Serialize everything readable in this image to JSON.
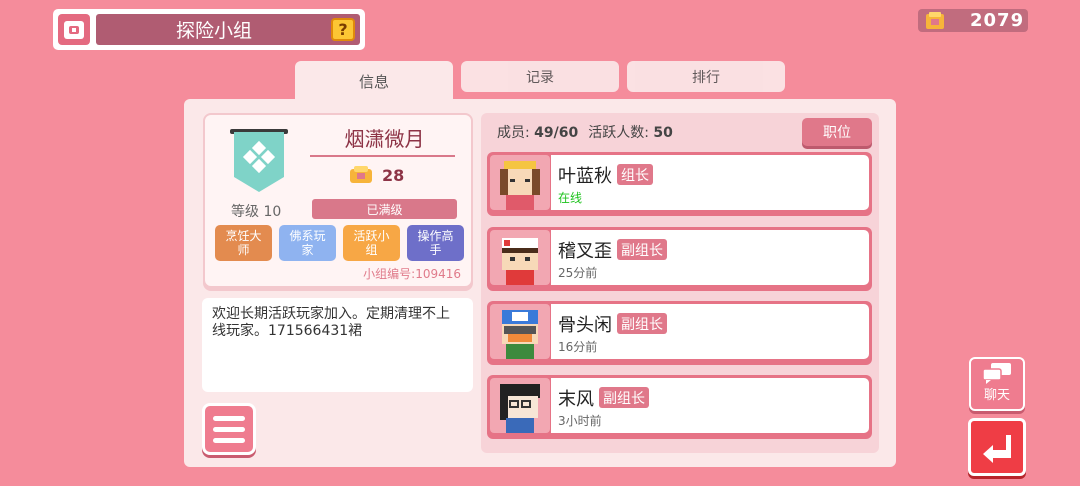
{
  "header": {
    "title": "探险小组",
    "help_label": "?",
    "coins": "2079"
  },
  "tabs": [
    {
      "label": "信息",
      "active": true
    },
    {
      "label": "记录",
      "active": false
    },
    {
      "label": "排行",
      "active": false
    }
  ],
  "group": {
    "name": "烟潇微月",
    "points": "28",
    "level": "等级 10",
    "level_status": "已满级",
    "tags": [
      {
        "label": "烹饪大师",
        "color": "#e38b4f"
      },
      {
        "label": "佛系玩家",
        "color": "#8fb3f0"
      },
      {
        "label": "活跃小组",
        "color": "#f7a745"
      },
      {
        "label": "操作高手",
        "color": "#6e6fc9"
      }
    ],
    "id_label": "小组编号:",
    "id_value": "109416",
    "description": "欢迎长期活跃玩家加入。定期清理不上线玩家。171566431裙"
  },
  "members_panel": {
    "members_label": "成员:",
    "members_value": "49/60",
    "active_label": "活跃人数:",
    "active_value": "50",
    "position_button": "职位"
  },
  "members": [
    {
      "name": "叶蓝秋",
      "role": "组长",
      "status": "在线",
      "online": true
    },
    {
      "name": "稽叉歪",
      "role": "副组长",
      "status": "25分前",
      "online": false
    },
    {
      "name": "骨头闲",
      "role": "副组长",
      "status": "16分前",
      "online": false
    },
    {
      "name": "末风",
      "role": "副组长",
      "status": "3小时前",
      "online": false
    }
  ],
  "side_buttons": {
    "chat_label": "聊天"
  }
}
